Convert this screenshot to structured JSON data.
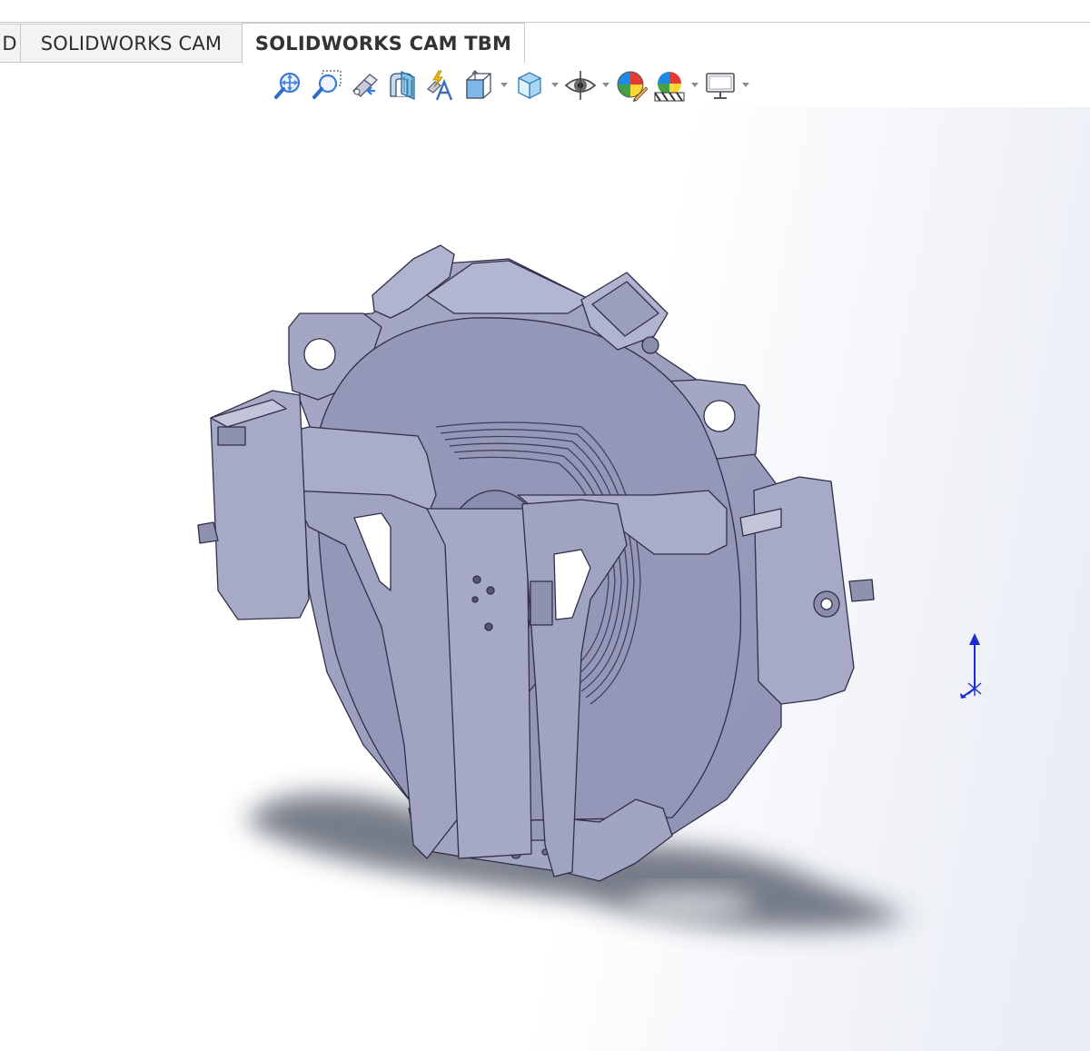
{
  "window": {
    "tabs": [
      {
        "label": "D",
        "active": false
      },
      {
        "label": "SOLIDWORKS CAM",
        "active": false
      },
      {
        "label": "SOLIDWORKS CAM TBM",
        "active": true
      }
    ]
  },
  "view_toolbar": {
    "buttons": [
      {
        "icon": "zoom-to-fit-icon",
        "has_dropdown": false
      },
      {
        "icon": "zoom-to-area-icon",
        "has_dropdown": false
      },
      {
        "icon": "previous-view-icon",
        "has_dropdown": false
      },
      {
        "icon": "section-view-icon",
        "has_dropdown": false
      },
      {
        "icon": "dynamic-annotation-views-icon",
        "has_dropdown": false
      },
      {
        "icon": "view-orientation-icon",
        "has_dropdown": true
      },
      {
        "icon": "display-style-icon",
        "has_dropdown": true
      },
      {
        "icon": "hide-show-items-icon",
        "has_dropdown": true
      },
      {
        "icon": "edit-appearance-icon",
        "has_dropdown": false
      },
      {
        "icon": "apply-scene-icon",
        "has_dropdown": true
      },
      {
        "icon": "view-settings-icon",
        "has_dropdown": true
      }
    ]
  },
  "colors": {
    "model_body": "#9a9dbd",
    "model_edge": "#2f3047",
    "shadow": "#4a5160",
    "triad_axis": "#1a2ad8",
    "tab_border": "#c9c9c9"
  }
}
